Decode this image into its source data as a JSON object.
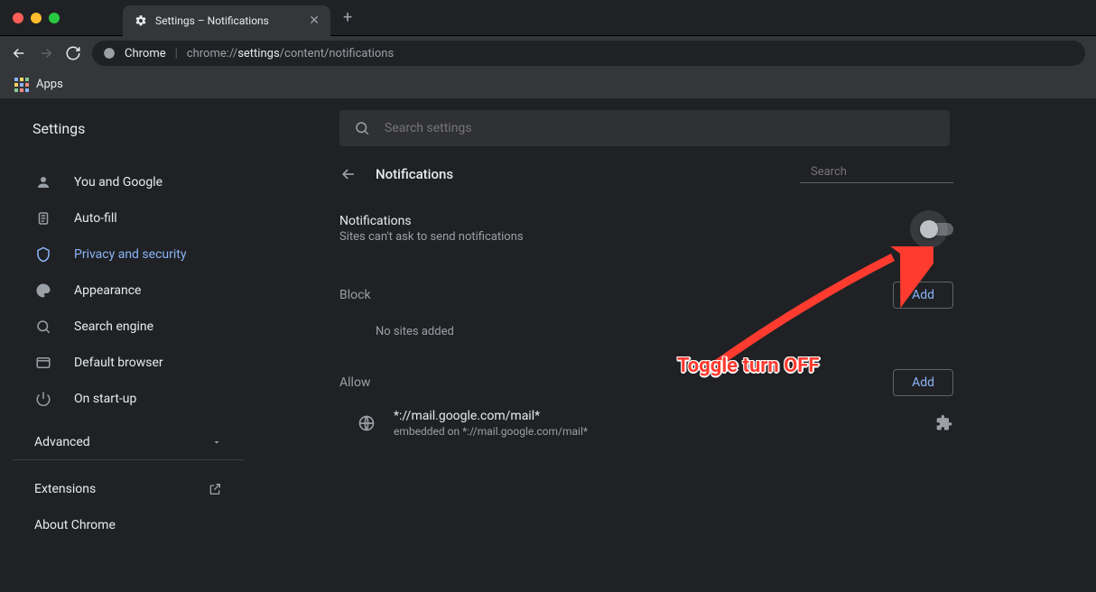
{
  "window": {
    "tab_title": "Settings – Notifications"
  },
  "omnibox": {
    "scheme_label": "Chrome",
    "url_prefix": "chrome://",
    "url_bold": "settings",
    "url_suffix": "/content/notifications"
  },
  "bookmarks": {
    "apps_label": "Apps"
  },
  "settings": {
    "header_title": "Settings",
    "search_placeholder": "Search settings",
    "sidebar": {
      "items": [
        {
          "label": "You and Google"
        },
        {
          "label": "Auto-fill"
        },
        {
          "label": "Privacy and security"
        },
        {
          "label": "Appearance"
        },
        {
          "label": "Search engine"
        },
        {
          "label": "Default browser"
        },
        {
          "label": "On start-up"
        }
      ],
      "advanced_label": "Advanced",
      "extensions_label": "Extensions",
      "about_label": "About Chrome"
    }
  },
  "panel": {
    "title": "Notifications",
    "search_placeholder": "Search",
    "toggle": {
      "title": "Notifications",
      "subtitle": "Sites can't ask to send notifications",
      "state": "off"
    },
    "block": {
      "label": "Block",
      "add_label": "Add",
      "empty_text": "No sites added"
    },
    "allow": {
      "label": "Allow",
      "add_label": "Add",
      "items": [
        {
          "pattern": "*://mail.google.com/mail*",
          "embedded": "embedded on *://mail.google.com/mail*"
        }
      ]
    }
  },
  "annotation": {
    "text": "Toggle turn OFF"
  }
}
